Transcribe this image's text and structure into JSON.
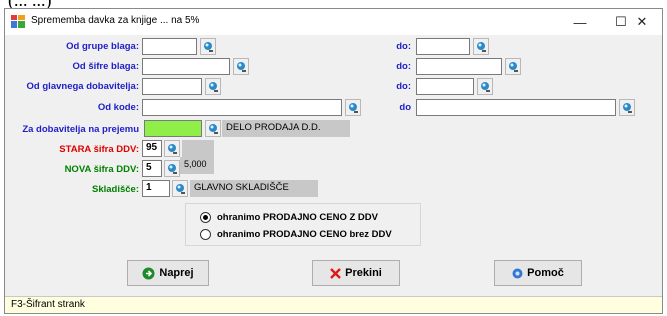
{
  "page_fragment": "(...                    ...)",
  "window": {
    "title": "Sprememba davka za knjige ... na 5%",
    "min_glyph": "—",
    "max_glyph": "☐",
    "close_glyph": "✕"
  },
  "form": {
    "od_grupe_label": "Od grupe blaga:",
    "od_grupe_value": "",
    "do_grupe_label": "do:",
    "do_grupe_value": "",
    "od_sifre_label": "Od šifre blaga:",
    "od_sifre_value": "",
    "do_sifre_label": "do:",
    "do_sifre_value": "",
    "od_dobavitelja_label": "Od glavnega dobavitelja:",
    "od_dobavitelja_value": "",
    "do_dobavitelja_label": "do:",
    "do_dobavitelja_value": "",
    "od_kode_label": "Od kode:",
    "od_kode_value": "",
    "do_kode_label": "do",
    "do_kode_value": "",
    "dobavitelj_label": "Za dobavitelja na prejemu",
    "dobavitelj_value": "",
    "dobavitelj_name": "DELO PRODAJA D.D.",
    "stara_label": "STARA šifra DDV:",
    "stara_value": "95",
    "stara_info": "",
    "nova_label": "NOVA šifra DDV:",
    "nova_value": "5",
    "nova_info": "5,000",
    "skladisce_label": "Skladišče:",
    "skladisce_value": "1",
    "skladisce_name": "GLAVNO SKLADIŠČE"
  },
  "options": [
    {
      "label": "ohranimo PRODAJNO CENO Z DDV",
      "selected": true
    },
    {
      "label": "ohranimo PRODAJNO CENO brez DDV",
      "selected": false
    }
  ],
  "buttons": {
    "naprej": "Naprej",
    "prekini": "Prekini",
    "pomoc": "Pomoč"
  },
  "status": "F3-Šifrant strank",
  "colors": {
    "label_blue": "#2020c8",
    "label_red": "#e00000",
    "label_green": "#008000",
    "highlight_field": "#90ee48",
    "status_bg": "#ffffe0"
  }
}
